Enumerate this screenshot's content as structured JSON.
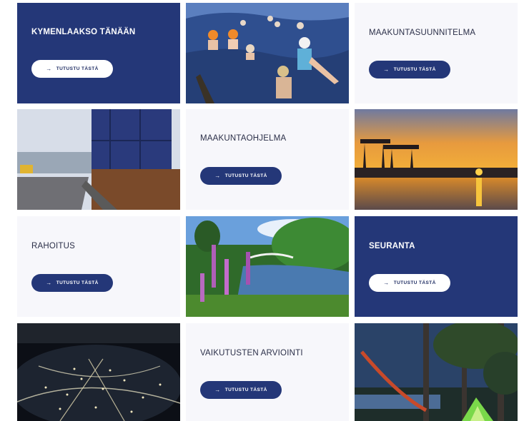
{
  "tiles": [
    {
      "title": "KYMENLAAKSO TÄNÄÄN",
      "button": "TUTUSTU TÄSTÄ"
    },
    {
      "title": "MAAKUNTASUUNNITELMA",
      "button": "TUTUSTU TÄSTÄ"
    },
    {
      "title": "MAAKUNTAOHJELMA",
      "button": "TUTUSTU TÄSTÄ"
    },
    {
      "title": "RAHOITUS",
      "button": "TUTUSTU TÄSTÄ"
    },
    {
      "title": "SEURANTA",
      "button": "TUTUSTU TÄSTÄ"
    },
    {
      "title": "VAIKUTUSTEN ARVIOINTI",
      "button": "TUTUSTU TÄSTÄ"
    }
  ],
  "icons": {
    "button_arrow": "arrow-right-icon"
  },
  "colors": {
    "navy": "#243778",
    "light_bg": "#f7f7fb",
    "text_dark": "#2b2f48",
    "white": "#ffffff"
  }
}
